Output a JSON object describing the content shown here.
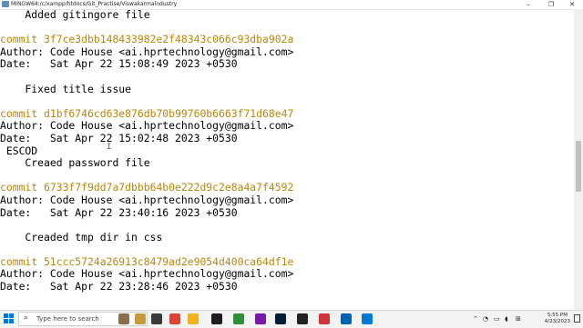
{
  "window": {
    "title": "MINGW64:/c/xampp/htdocs/Git_Practise/Viswakarmalndustry",
    "minimize": "–",
    "maximize": "❐",
    "close": "✕"
  },
  "terminal": {
    "lines": [
      {
        "text": "    Added gitingore file",
        "type": "text"
      },
      {
        "text": "",
        "type": "blank"
      },
      {
        "text": "commit 3f7ce3dbb148433982e2f48343c066c93dba902a",
        "type": "commit"
      },
      {
        "text": "Author: Code House <ai.hprtechnology@gmail.com>",
        "type": "text"
      },
      {
        "text": "Date:   Sat Apr 22 15:08:49 2023 +0530",
        "type": "text"
      },
      {
        "text": "",
        "type": "blank"
      },
      {
        "text": "    Fixed title issue",
        "type": "text"
      },
      {
        "text": "",
        "type": "blank"
      },
      {
        "text": "commit d1bf6746cd63e876db70b99760b6663f71d68e47",
        "type": "commit"
      },
      {
        "text": "Author: Code House <ai.hprtechnology@gmail.com>",
        "type": "text"
      },
      {
        "text": "Date:   Sat Apr 22 15:02:48 2023 +0530",
        "type": "text"
      },
      {
        "text": " ESCOD",
        "type": "text"
      },
      {
        "text": "    Creaed password file",
        "type": "text"
      },
      {
        "text": "",
        "type": "blank"
      },
      {
        "text": "commit 6733f7f9dd7a7dbbb64b0e222d9c2e8a4a7f4592",
        "type": "commit"
      },
      {
        "text": "Author: Code House <ai.hprtechnology@gmail.com>",
        "type": "text"
      },
      {
        "text": "Date:   Sat Apr 22 23:40:16 2023 +0530",
        "type": "text"
      },
      {
        "text": "",
        "type": "blank"
      },
      {
        "text": "    Creaded tmp dir in css",
        "type": "text"
      },
      {
        "text": "",
        "type": "blank"
      },
      {
        "text": "commit 51ccc5724a26913c8479ad2e9054d400ca64df1e",
        "type": "commit"
      },
      {
        "text": "Author: Code House <ai.hprtechnology@gmail.com>",
        "type": "text"
      },
      {
        "text": "Date:   Sat Apr 22 23:28:46 2023 +0530",
        "type": "text"
      },
      {
        "text": "",
        "type": "blank"
      }
    ],
    "cursor_glyph": "I"
  },
  "taskbar": {
    "search_placeholder": "Type here to search",
    "apps": [
      {
        "name": "person-icon",
        "color": "#8a6d4b"
      },
      {
        "name": "game-icon",
        "color": "#c79a3a"
      },
      {
        "name": "task-view-icon",
        "color": "#3a3a3a"
      },
      {
        "name": "chrome-icon",
        "color": "#db4437"
      },
      {
        "name": "file-explorer-icon",
        "color": "#f2b21b"
      },
      {
        "name": "terminal-icon",
        "color": "#1e1e1e"
      },
      {
        "name": "store-icon",
        "color": "#2f8f3a"
      },
      {
        "name": "onenote-icon",
        "color": "#7719aa"
      },
      {
        "name": "photoshop-icon",
        "color": "#001e36"
      },
      {
        "name": "obs-icon",
        "color": "#222222"
      },
      {
        "name": "edge-icon",
        "color": "#d13438"
      },
      {
        "name": "app-icon",
        "color": "#0063b1"
      },
      {
        "name": "vscode-icon",
        "color": "#0078d4"
      }
    ],
    "time": "5:55 PM",
    "date": "4/23/2023"
  },
  "colors": {
    "commit": "#b8860b",
    "text": "#000000",
    "background": "#ffffff"
  }
}
